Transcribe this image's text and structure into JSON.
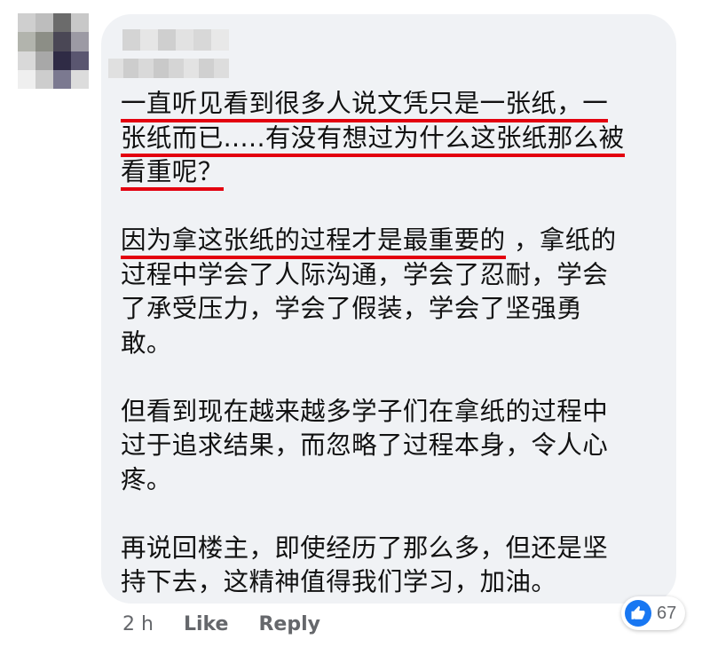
{
  "comment": {
    "paragraphs": [
      [
        "一直听见看到很多人说文凭只是一张纸，一",
        "张纸而已.....有没有想过为什么这张纸那么被",
        "看重呢？"
      ],
      [
        "因为拿这张纸的过程才是最重要的",
        " ，拿纸的",
        "过程中学会了人际沟通，学会了忍耐，学会",
        "了承受压力，学会了假装，学会了坚强勇",
        "敢。"
      ],
      [
        "但看到现在越来越多学子们在拿纸的过程中",
        "过于追求结果，而忽略了过程本身，令人心",
        "疼。"
      ],
      [
        "再说回楼主，即使经历了那么多，但还是坚",
        "持下去，这精神值得我们学习，加油。"
      ]
    ],
    "underline_color": "#e3000f"
  },
  "meta": {
    "time": "2 h",
    "like_label": "Like",
    "reply_label": "Reply"
  },
  "reactions": {
    "icon": "thumbs-up-icon",
    "count": "67",
    "color": "#1877f2"
  },
  "colors": {
    "bubble": "#f0f2f5",
    "meta_text": "#65676b"
  }
}
